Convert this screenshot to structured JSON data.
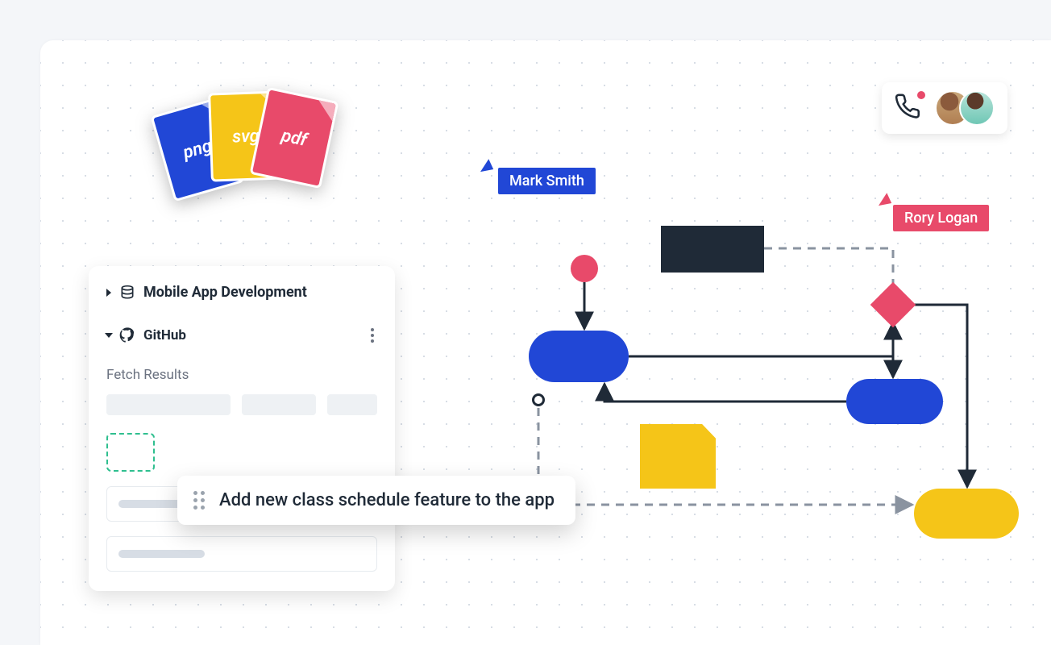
{
  "export_formats": {
    "png": "png",
    "svg": "svg",
    "pdf": "pdf"
  },
  "collab": {
    "call_active": true
  },
  "cursors": {
    "user1": "Mark Smith",
    "user2": "Rory Logan"
  },
  "panel": {
    "project_title": "Mobile App Development",
    "integration_name": "GitHub",
    "section_label": "Fetch Results"
  },
  "floating_card": {
    "text": "Add new class schedule feature to the app"
  },
  "colors": {
    "blue": "#2147d6",
    "yellow": "#f5c518",
    "red": "#e84a6a",
    "dark": "#1f2a37"
  }
}
